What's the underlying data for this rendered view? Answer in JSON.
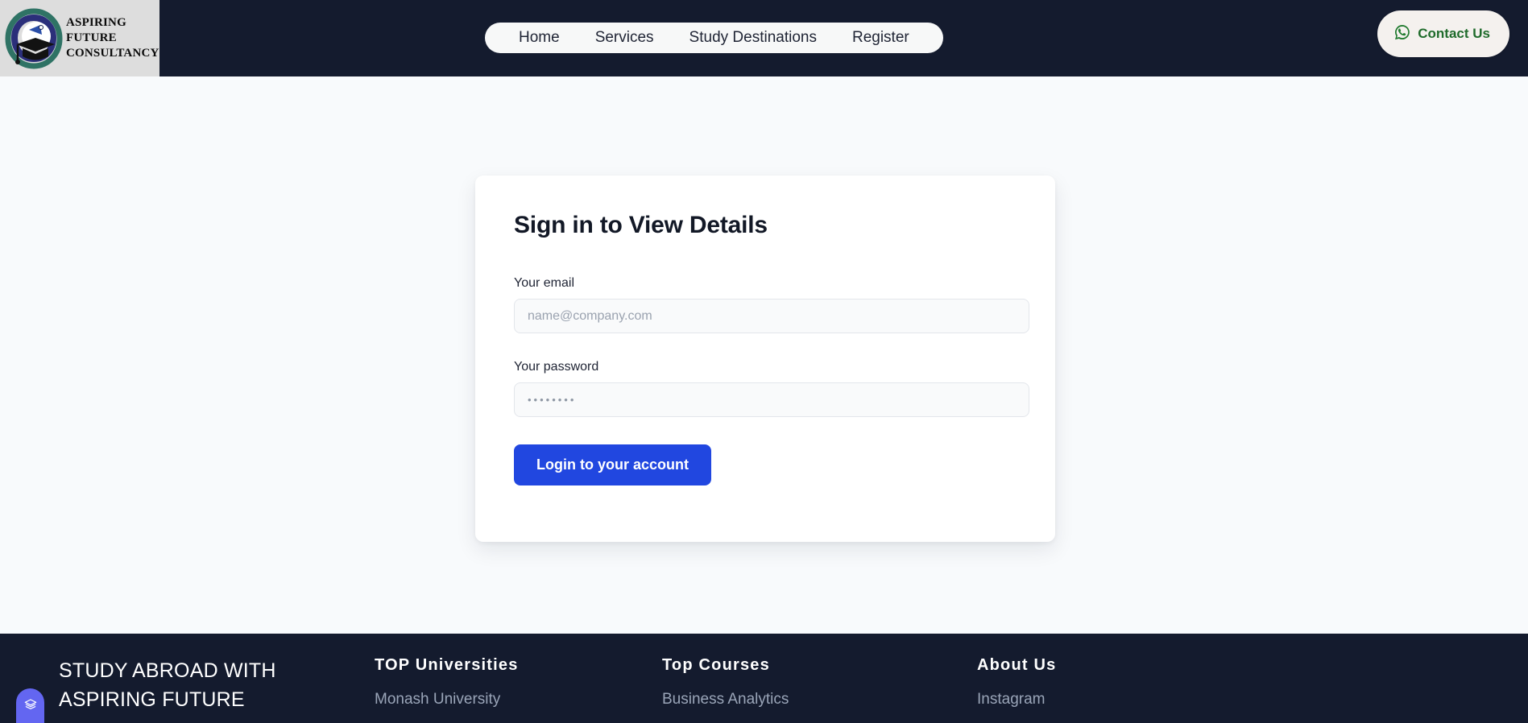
{
  "header": {
    "logo": {
      "icon": "graduation-cap-emblem-icon",
      "line1": "ASPIRING",
      "line2": "FUTURE",
      "line3": "CONSULTANCY"
    },
    "nav": [
      {
        "label": "Home"
      },
      {
        "label": "Services"
      },
      {
        "label": "Study Destinations"
      },
      {
        "label": "Register"
      }
    ],
    "contact": {
      "label": "Contact Us",
      "icon": "whatsapp-icon"
    },
    "colors": {
      "bar_background": "#141b2e",
      "nav_pill_background": "#f7f8f8",
      "contact_text": "#1f6b2b"
    }
  },
  "main": {
    "card": {
      "title": "Sign in to View Details",
      "email": {
        "label": "Your email",
        "placeholder": "name@company.com",
        "value": ""
      },
      "password": {
        "label": "Your password",
        "placeholder": "••••••••",
        "value": ""
      },
      "submit_label": "Login to your account",
      "submit_color": "#2147e0"
    },
    "background": "#f8fafc"
  },
  "footer": {
    "brand": "STUDY ABROAD WITH ASPIRING FUTURE",
    "columns": [
      {
        "title": "TOP Universities",
        "links": [
          {
            "label": "Monash University"
          }
        ]
      },
      {
        "title": "Top Courses",
        "links": [
          {
            "label": "Business Analytics"
          }
        ]
      },
      {
        "title": "About Us",
        "links": [
          {
            "label": "Instagram"
          }
        ]
      }
    ],
    "background": "#141b2e"
  },
  "widget": {
    "icon": "layers-stack-icon",
    "color": "#6366f1"
  }
}
